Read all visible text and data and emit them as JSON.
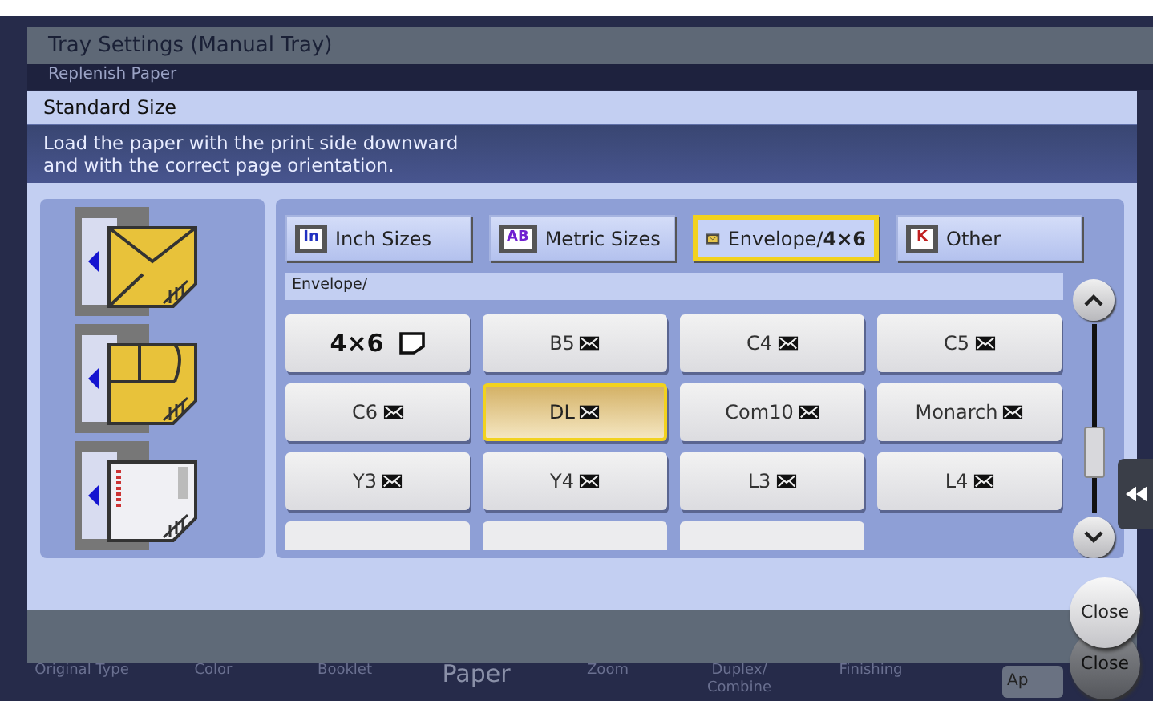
{
  "background_window": {
    "title": "Tray Settings (Manual Tray)",
    "subtitle": "Replenish Paper"
  },
  "dialog": {
    "title": "Standard Size",
    "message": "Load the paper with the print side downward\nand with the correct page orientation."
  },
  "tabs": [
    {
      "label": "Inch Sizes",
      "badge": "In",
      "kind": "inch",
      "selected": false
    },
    {
      "label": "Metric Sizes",
      "badge": "AB",
      "kind": "metric",
      "selected": false
    },
    {
      "label": "Envelope/**4×6**",
      "kind": "envelope",
      "selected": true
    },
    {
      "label": "Other",
      "badge": "K",
      "kind": "other",
      "selected": false
    }
  ],
  "section_label": "Envelope/",
  "sizes": [
    {
      "label": "4×6",
      "kind": "card",
      "selected": false
    },
    {
      "label": "B5",
      "kind": "envelope",
      "selected": false
    },
    {
      "label": "C4",
      "kind": "envelope",
      "selected": false
    },
    {
      "label": "C5",
      "kind": "envelope",
      "selected": false
    },
    {
      "label": "C6",
      "kind": "envelope",
      "selected": false
    },
    {
      "label": "DL",
      "kind": "envelope",
      "selected": true
    },
    {
      "label": "Com10",
      "kind": "envelope",
      "selected": false
    },
    {
      "label": "Monarch",
      "kind": "envelope",
      "selected": false
    },
    {
      "label": "Y3",
      "kind": "envelope",
      "selected": false
    },
    {
      "label": "Y4",
      "kind": "envelope",
      "selected": false
    },
    {
      "label": "L3",
      "kind": "envelope",
      "selected": false
    },
    {
      "label": "L4",
      "kind": "envelope",
      "selected": false
    }
  ],
  "close_buttons": [
    {
      "label": "Close",
      "disabled": false
    },
    {
      "label": "Close",
      "disabled": true
    }
  ],
  "function_tabs": [
    {
      "label": "Original Type",
      "selected": false
    },
    {
      "label": "Color",
      "selected": false
    },
    {
      "label": "Booklet",
      "selected": false
    },
    {
      "label": "Paper",
      "selected": true
    },
    {
      "label": "Zoom",
      "selected": false
    },
    {
      "label": "Duplex/\nCombine",
      "selected": false
    },
    {
      "label": "Finishing",
      "selected": false
    }
  ],
  "apply_button": "Ap"
}
